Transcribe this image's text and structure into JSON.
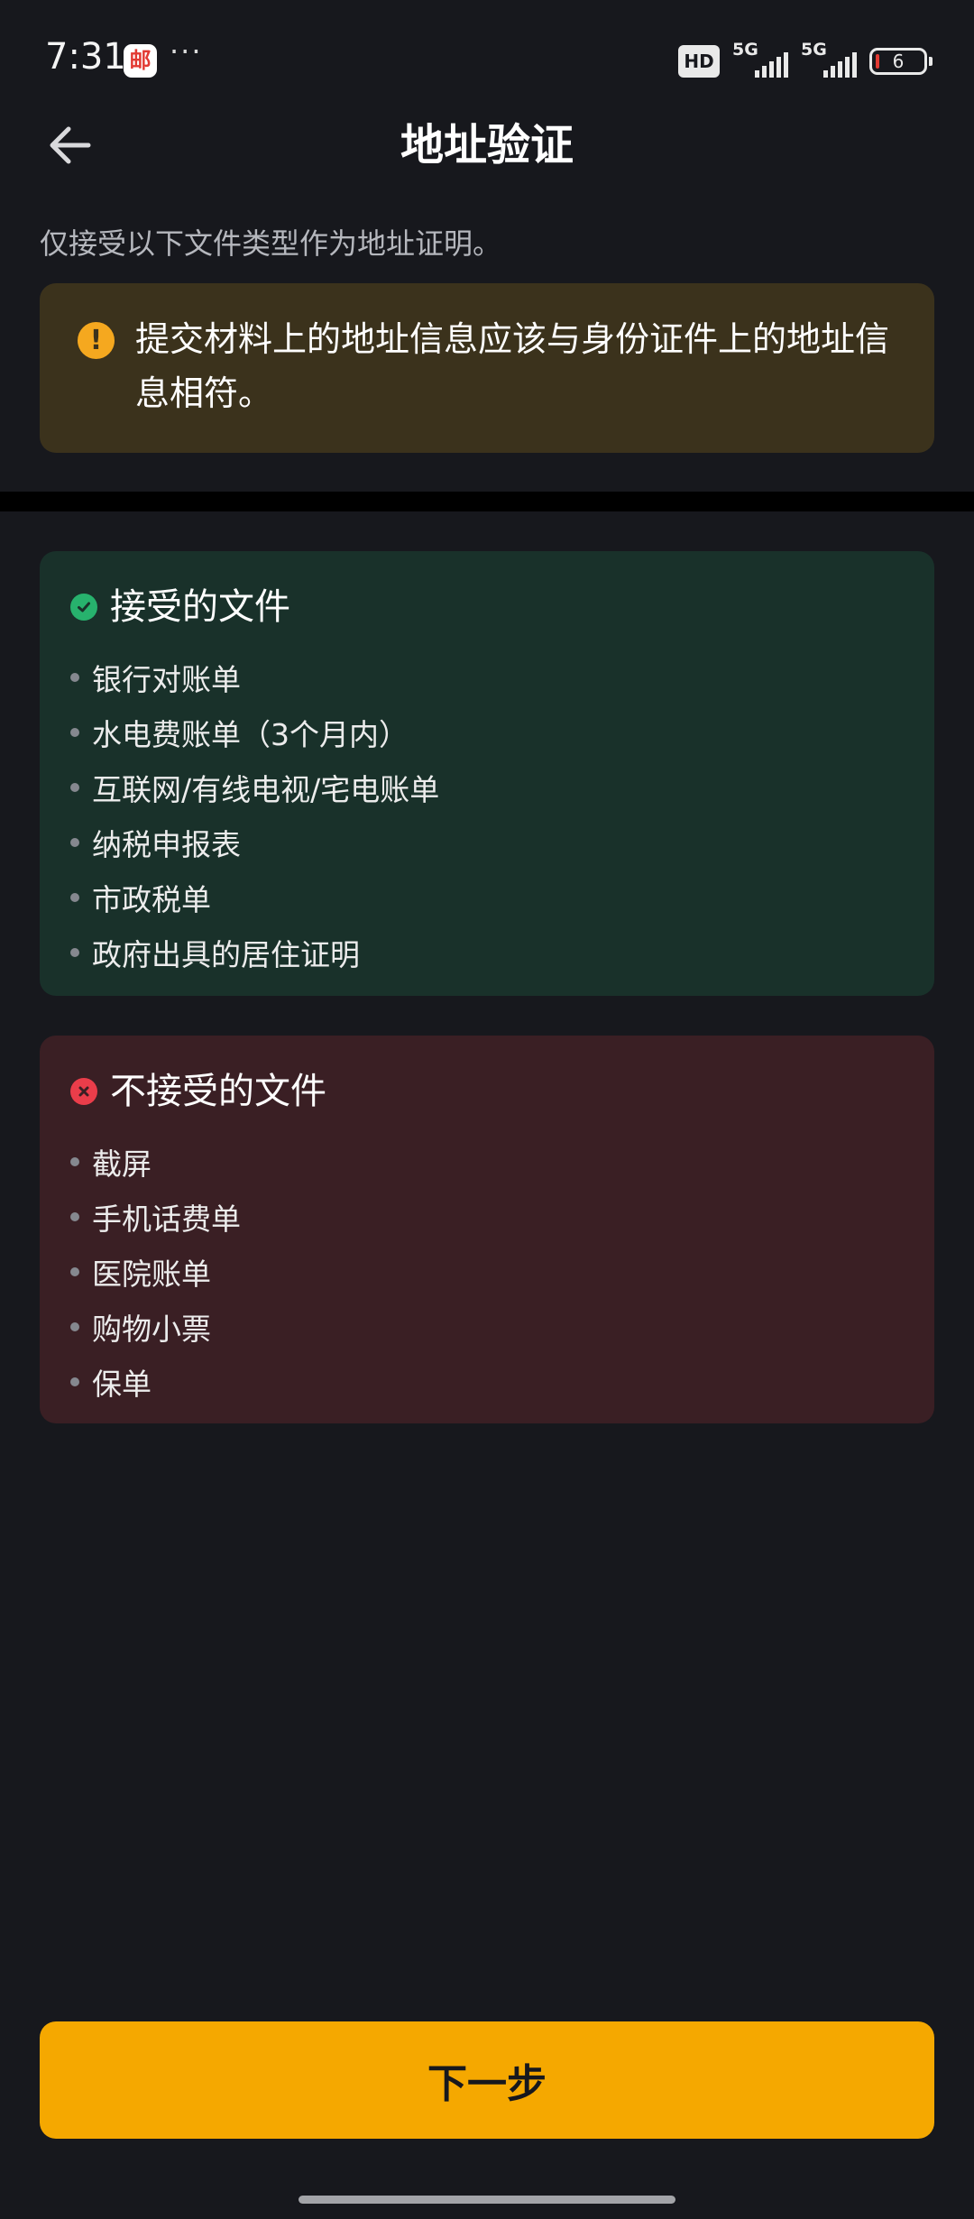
{
  "status_bar": {
    "time": "7:31",
    "app_icon_glyph": "邮",
    "more": "···",
    "hd_label": "HD",
    "network_1": "5G",
    "network_2": "5G",
    "battery": "6"
  },
  "header": {
    "title": "地址验证",
    "back_icon": "arrow-left-icon"
  },
  "intro_text": "仅接受以下文件类型作为地址证明。",
  "warning": {
    "icon": "exclamation-icon",
    "text": "提交材料上的地址信息应该与身份证件上的地址信息相符。"
  },
  "accepted": {
    "title": "接受的文件",
    "items": [
      "银行对账单",
      "水电费账单（3个月内）",
      "互联网/有线电视/宅电账单",
      "纳税申报表",
      "市政税单",
      "政府出具的居住证明"
    ]
  },
  "rejected": {
    "title": "不接受的文件",
    "items": [
      "截屏",
      "手机话费单",
      "医院账单",
      "购物小票",
      "保单"
    ]
  },
  "next_button": "下一步",
  "colors": {
    "background": "#17181d",
    "accent": "#f5a800",
    "warning_bg": "#3b321c",
    "accepted_bg": "#19312a",
    "rejected_bg": "#3a1f24",
    "ok_green": "#27b26d",
    "error_red": "#ea3d4a"
  }
}
